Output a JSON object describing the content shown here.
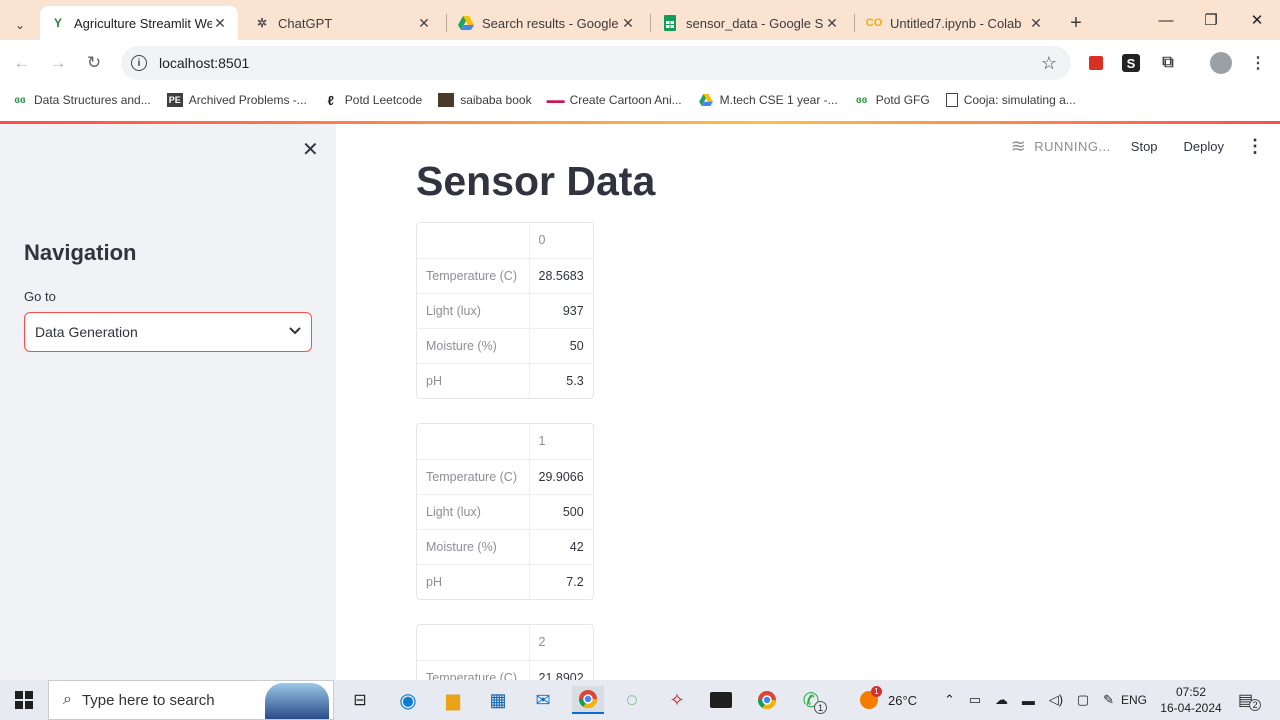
{
  "tabs": [
    {
      "title": "Agriculture Streamlit Wel",
      "icon": "streamlit-sprout-icon",
      "active": true
    },
    {
      "title": "ChatGPT",
      "icon": "chatgpt-icon"
    },
    {
      "title": "Search results - Google D",
      "icon": "google-drive-icon"
    },
    {
      "title": "sensor_data - Google She",
      "icon": "google-sheets-icon"
    },
    {
      "title": "Untitled7.ipynb - Colab",
      "icon": "colab-icon"
    }
  ],
  "address": {
    "url": "localhost:8501"
  },
  "bookmarks": [
    {
      "label": "Data Structures and...",
      "icon": "gfg-icon"
    },
    {
      "label": "Archived Problems -...",
      "icon": "pe-icon"
    },
    {
      "label": "Potd Leetcode",
      "icon": "leetcode-icon"
    },
    {
      "label": "saibaba book",
      "icon": "book-icon"
    },
    {
      "label": "Create Cartoon Ani...",
      "icon": "cartoon-icon"
    },
    {
      "label": "M.tech CSE 1 year -...",
      "icon": "google-drive-icon"
    },
    {
      "label": "Potd GFG",
      "icon": "gfg-icon"
    },
    {
      "label": "Cooja: simulating a...",
      "icon": "document-icon"
    }
  ],
  "sidebar": {
    "heading": "Navigation",
    "select_label": "Go to",
    "select_value": "Data Generation"
  },
  "header": {
    "status": "RUNNING...",
    "stop": "Stop",
    "deploy": "Deploy"
  },
  "main": {
    "title": "Sensor Data",
    "tables": [
      {
        "col": "0",
        "rows": [
          {
            "label": "Temperature (C)",
            "value": "28.5683"
          },
          {
            "label": "Light (lux)",
            "value": "937"
          },
          {
            "label": "Moisture (%)",
            "value": "50"
          },
          {
            "label": "pH",
            "value": "5.3"
          }
        ]
      },
      {
        "col": "1",
        "rows": [
          {
            "label": "Temperature (C)",
            "value": "29.9066"
          },
          {
            "label": "Light (lux)",
            "value": "500"
          },
          {
            "label": "Moisture (%)",
            "value": "42"
          },
          {
            "label": "pH",
            "value": "7.2"
          }
        ]
      },
      {
        "col": "2",
        "rows": [
          {
            "label": "Temperature (C)",
            "value": "21.8902"
          }
        ]
      }
    ]
  },
  "taskbar": {
    "search_placeholder": "Type here to search",
    "weather": "26°C",
    "weather_badge": "1",
    "language": "ENG",
    "time": "07:52",
    "date": "16-04-2024",
    "notifications": "2",
    "whatsapp_badge": "1"
  },
  "colors": {
    "accent": "#ff4b4b",
    "sidebar_bg": "#f0f2f6",
    "tabstrip_bg": "#fbe3d2"
  }
}
